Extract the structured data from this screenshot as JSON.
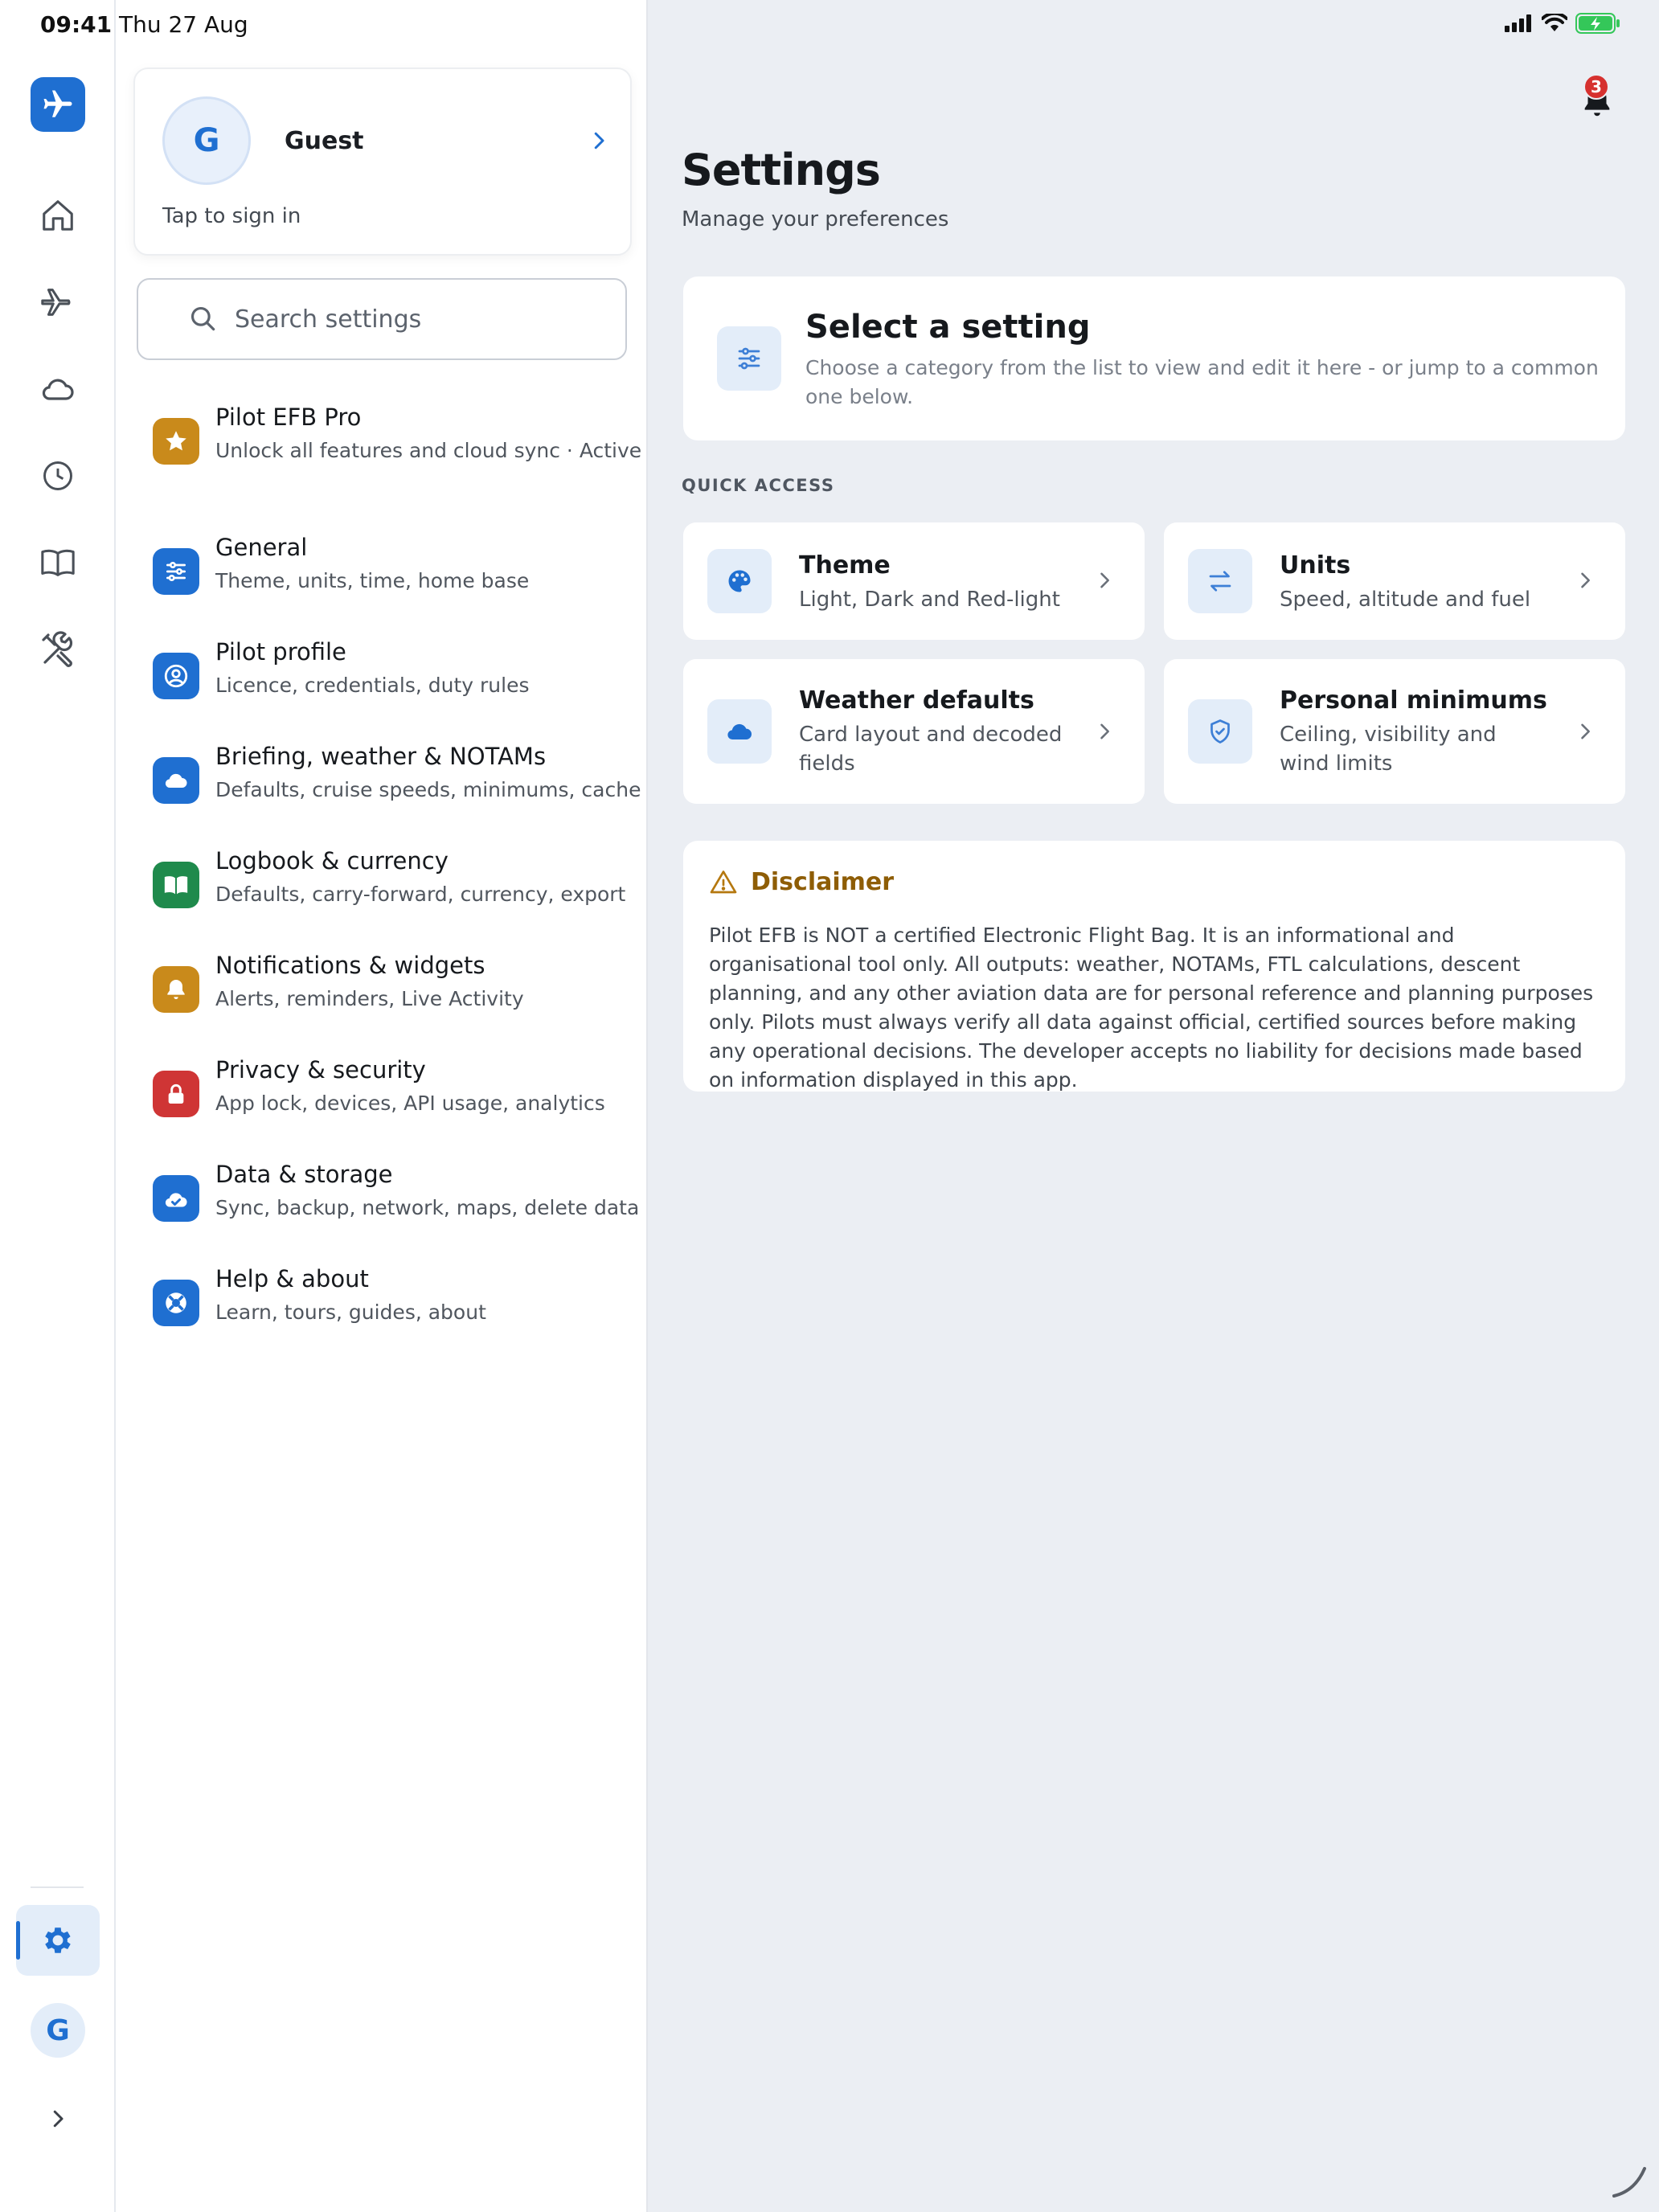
{
  "status_bar": {
    "time": "09:41",
    "date": "Thu 27 Aug",
    "battery_color": "#34c759"
  },
  "rail": {
    "items": [
      {
        "name": "home-icon"
      },
      {
        "name": "airplane-icon"
      },
      {
        "name": "cloud-icon"
      },
      {
        "name": "clock-icon"
      },
      {
        "name": "book-icon"
      },
      {
        "name": "tools-icon"
      }
    ],
    "active": "gear-icon",
    "avatar_initial": "G"
  },
  "profile": {
    "initial": "G",
    "name": "Guest",
    "subtitle": "Tap to sign in"
  },
  "search": {
    "placeholder": "Search settings"
  },
  "categories": [
    {
      "title": "Pilot EFB Pro",
      "subtitle": "Unlock all features and cloud sync · Active",
      "color": "#c98a1b",
      "icon": "star-icon"
    },
    {
      "title": "General",
      "subtitle": "Theme, units, time, home base",
      "color": "#1f6fd1",
      "icon": "sliders-icon"
    },
    {
      "title": "Pilot profile",
      "subtitle": "Licence, credentials, duty rules",
      "color": "#1f6fd1",
      "icon": "user-circle-icon"
    },
    {
      "title": "Briefing, weather & NOTAMs",
      "subtitle": "Defaults, cruise speeds, minimums, cache",
      "color": "#1f6fd1",
      "icon": "cloud-icon"
    },
    {
      "title": "Logbook & currency",
      "subtitle": "Defaults, carry-forward, currency, export",
      "color": "#1f8a4c",
      "icon": "open-book-icon"
    },
    {
      "title": "Notifications & widgets",
      "subtitle": "Alerts, reminders, Live Activity",
      "color": "#c98a1b",
      "icon": "bell-icon"
    },
    {
      "title": "Privacy & security",
      "subtitle": "App lock, devices, API usage, analytics",
      "color": "#cf3535",
      "icon": "lock-icon"
    },
    {
      "title": "Data & storage",
      "subtitle": "Sync, backup, network, maps, delete data",
      "color": "#1f6fd1",
      "icon": "cloud-check-icon"
    },
    {
      "title": "Help & about",
      "subtitle": "Learn, tours, guides, about",
      "color": "#1f6fd1",
      "icon": "lifebuoy-icon"
    }
  ],
  "header": {
    "title": "Settings",
    "subtitle": "Manage your preferences",
    "notification_count": "3"
  },
  "select_card": {
    "title": "Select a setting",
    "description": "Choose a category from the list to view and edit it here - or jump to a common one below."
  },
  "quick_access": {
    "label": "QUICK ACCESS",
    "items": [
      {
        "title": "Theme",
        "subtitle": "Light, Dark and Red-light",
        "icon": "palette-icon"
      },
      {
        "title": "Units",
        "subtitle": "Speed, altitude and fuel",
        "icon": "swap-arrows-icon"
      },
      {
        "title": "Weather defaults",
        "subtitle": "Card layout and decoded fields",
        "icon": "cloud-icon"
      },
      {
        "title": "Personal minimums",
        "subtitle": "Ceiling, visibility and wind limits",
        "icon": "shield-check-icon"
      }
    ]
  },
  "disclaimer": {
    "title": "Disclaimer",
    "body": "Pilot EFB is NOT a certified Electronic Flight Bag. It is an informational and organisational tool only. All outputs: weather, NOTAMs, FTL calculations, descent planning, and any other aviation data are for personal reference and planning purposes only. Pilots must always verify all data against official, certified sources before making any operational decisions. The developer accepts no liability for decisions made based on information displayed in this app."
  }
}
